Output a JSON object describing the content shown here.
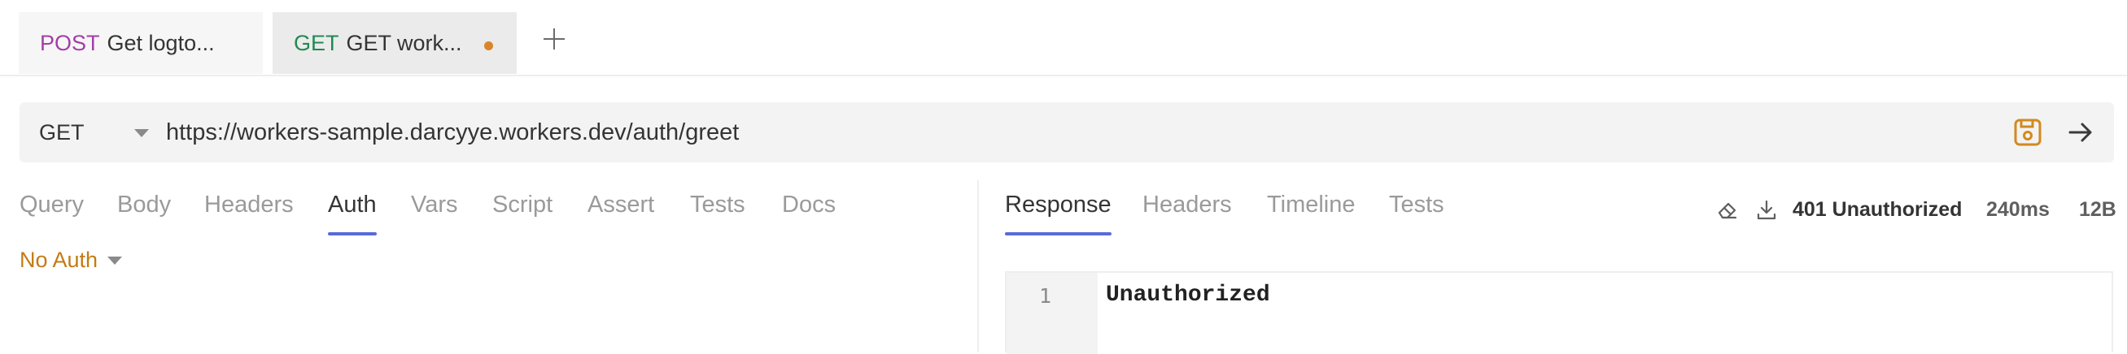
{
  "tabs": [
    {
      "method": "POST",
      "method_color": "#a23fa6",
      "title": "Get logto...",
      "active": false
    },
    {
      "method": "GET",
      "method_color": "#1f8a52",
      "title": "GET work...",
      "active": true,
      "unsaved_dot_color": "#d9852b"
    }
  ],
  "request": {
    "method": "GET",
    "url": "https://workers-sample.darcyye.workers.dev/auth/greet",
    "tabs": [
      "Query",
      "Body",
      "Headers",
      "Auth",
      "Vars",
      "Script",
      "Assert",
      "Tests",
      "Docs"
    ],
    "active_tab": "Auth",
    "auth_mode": "No Auth"
  },
  "response": {
    "tabs": [
      "Response",
      "Headers",
      "Timeline",
      "Tests"
    ],
    "active_tab": "Response",
    "status": "401 Unauthorized",
    "time": "240ms",
    "size": "12B",
    "lines": [
      {
        "number": "1",
        "text": "Unauthorized"
      }
    ]
  },
  "icons": {
    "new_tab": "plus-icon",
    "save": "save-icon",
    "send": "arrow-right-icon",
    "clear": "eraser-icon",
    "download": "download-icon"
  },
  "colors": {
    "accent": "#5a6ad6",
    "auth_mode": "#c47a14",
    "save_icon": "#d28a1f"
  }
}
